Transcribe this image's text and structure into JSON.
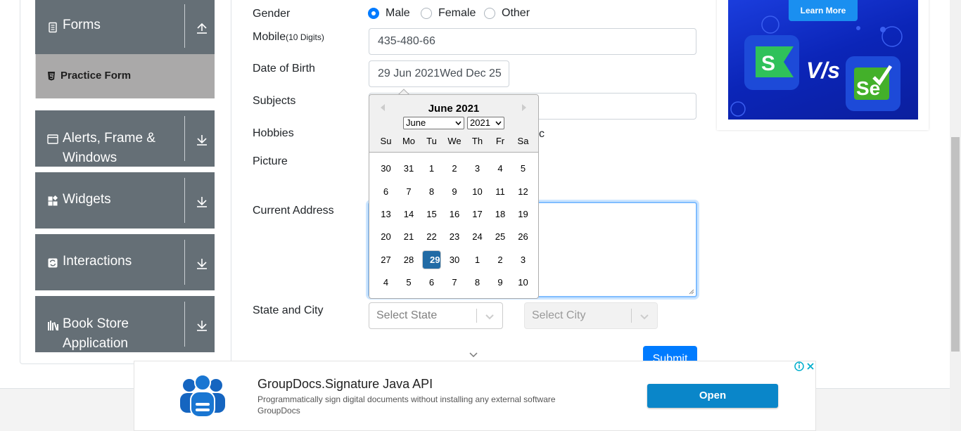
{
  "sidebar": {
    "groups": [
      {
        "label": "Forms",
        "icon": "form-icon",
        "arrow": "collapse-arrow-icon"
      },
      {
        "label": "Alerts, Frame &\nWindows",
        "icon": "window-icon",
        "arrow": "expand-arrow-icon"
      },
      {
        "label": "Widgets",
        "icon": "widgets-icon",
        "arrow": "expand-arrow-icon"
      },
      {
        "label": "Interactions",
        "icon": "interactions-icon",
        "arrow": "expand-arrow-icon"
      },
      {
        "label": "Book Store\nApplication",
        "icon": "bookstore-icon",
        "arrow": "expand-arrow-icon"
      }
    ],
    "active_item": "Practice Form"
  },
  "form": {
    "gender_label": "Gender",
    "gender_options": [
      {
        "label": "Male",
        "checked": true
      },
      {
        "label": "Female",
        "checked": false
      },
      {
        "label": "Other",
        "checked": false
      }
    ],
    "mobile_label": "Mobile",
    "mobile_hint": "(10 Digits)",
    "mobile_value": "435-480-66",
    "dob_label": "Date of Birth",
    "dob_value": "29 Jun 2021Wed Dec 25",
    "subjects_label": "Subjects",
    "hobbies_label": "Hobbies",
    "hobbies_partial": "c",
    "picture_label": "Picture",
    "address_label": "Current Address",
    "state_city_label": "State and City",
    "state_placeholder": "Select State",
    "city_placeholder": "Select City",
    "submit_label": "Submit"
  },
  "datepicker": {
    "title": "June 2021",
    "month_select": "June",
    "year_select": "2021",
    "weekdays": [
      "Su",
      "Mo",
      "Tu",
      "We",
      "Th",
      "Fr",
      "Sa"
    ],
    "weeks": [
      [
        "30",
        "31",
        "1",
        "2",
        "3",
        "4",
        "5"
      ],
      [
        "6",
        "7",
        "8",
        "9",
        "10",
        "11",
        "12"
      ],
      [
        "13",
        "14",
        "15",
        "16",
        "17",
        "18",
        "19"
      ],
      [
        "20",
        "21",
        "22",
        "23",
        "24",
        "25",
        "26"
      ],
      [
        "27",
        "28",
        "29",
        "30",
        "1",
        "2",
        "3"
      ],
      [
        "4",
        "5",
        "6",
        "7",
        "8",
        "9",
        "10"
      ]
    ],
    "selected": "29"
  },
  "ad_top": {
    "learn_more": "Learn More",
    "vs_text": "V/s"
  },
  "ad_bottom": {
    "title": "GroupDocs.Signature Java API",
    "description": "Programmatically sign digital documents without installing any external software",
    "brand": "GroupDocs",
    "button": "Open"
  },
  "colors": {
    "sidebar_bg": "#656f76",
    "active_item_bg": "#aaa9a9",
    "accent": "#007bff",
    "datepicker_selected": "#216ba5",
    "ad_button": "#0a86c9"
  }
}
